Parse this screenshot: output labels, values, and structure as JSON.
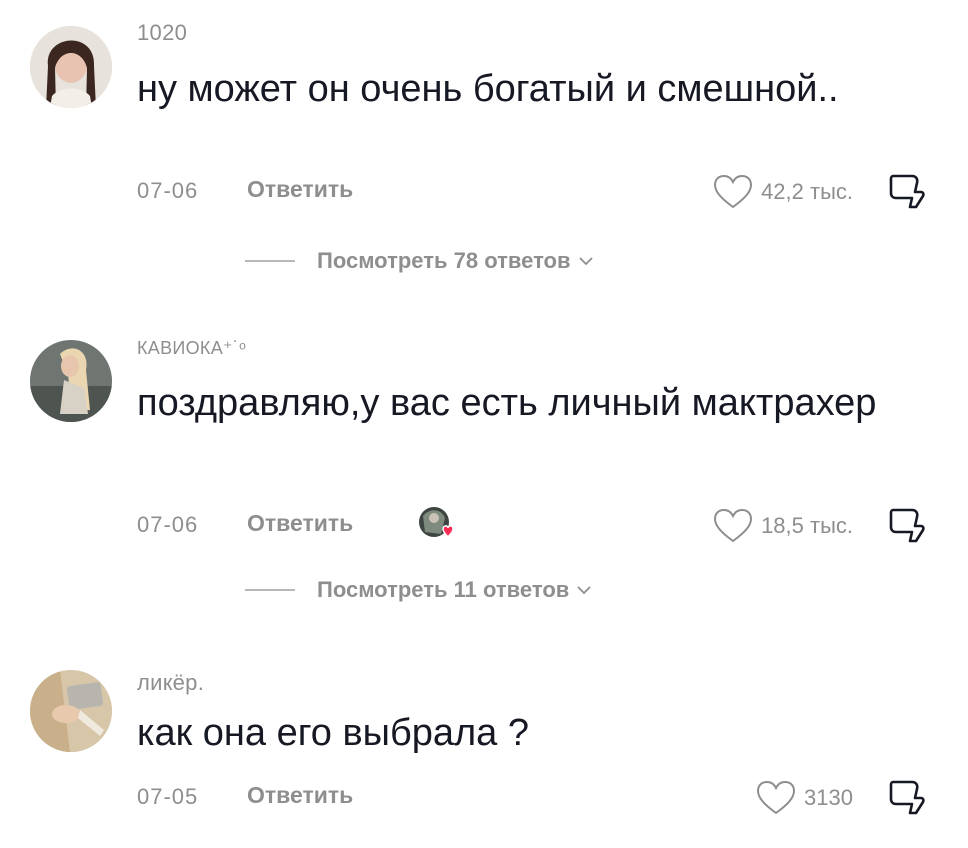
{
  "comments": [
    {
      "username": "1020",
      "text": "ну может он очень богатый и смешной..",
      "date": "07-06",
      "reply_label": "Ответить",
      "likes": "42,2 тыс.",
      "view_replies": "Посмотреть 78 ответов",
      "liked_by_creator": false
    },
    {
      "username": "КАВИОКА⁺˙ᵒ",
      "text": "поздравляю,у вас есть личный мактрахер",
      "date": "07-06",
      "reply_label": "Ответить",
      "likes": "18,5 тыс.",
      "view_replies": "Посмотреть 11 ответов",
      "liked_by_creator": true
    },
    {
      "username": "ликёр.",
      "text": "как она его выбрала ?",
      "date": "07-05",
      "reply_label": "Ответить",
      "likes": "3130",
      "liked_by_creator": false
    }
  ],
  "icons": {
    "like": "heart-outline-icon",
    "dislike": "thumbs-down-icon",
    "expand": "chevron-down-icon",
    "creator_like_badge": "red-heart-icon"
  },
  "colors": {
    "text": "#161823",
    "secondary": "#8e8e8e",
    "badge_heart": "#fe2c55"
  }
}
